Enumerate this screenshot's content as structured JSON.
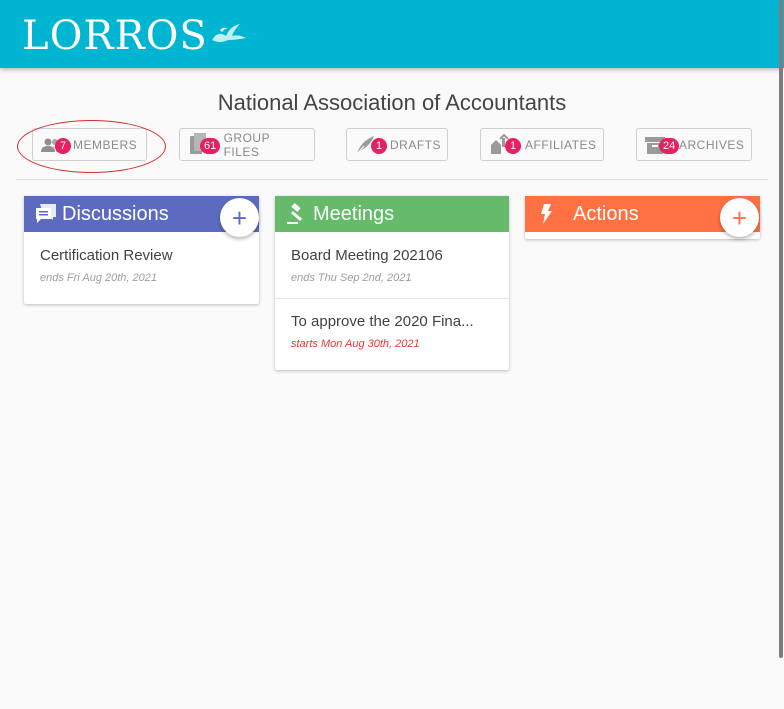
{
  "brand": {
    "logo_text": "LORROS",
    "bar_color": "#00b5d1"
  },
  "group_title": "National Association of Accountants",
  "tabs": [
    {
      "label": "MEMBERS",
      "count": "7",
      "icon": "people-icon"
    },
    {
      "label": "GROUP FILES",
      "count": "61",
      "icon": "files-icon"
    },
    {
      "label": "DRAFTS",
      "count": "1",
      "icon": "quill-icon"
    },
    {
      "label": "AFFILIATES",
      "count": "1",
      "icon": "affiliates-icon"
    },
    {
      "label": "ARCHIVES",
      "count": "24",
      "icon": "archive-icon"
    }
  ],
  "columns": {
    "discussions": {
      "title": "Discussions",
      "color": "#5c6bc0",
      "add_label": "+",
      "items": [
        {
          "title": "Certification Review",
          "subtitle": "ends Fri Aug 20th, 2021"
        }
      ]
    },
    "meetings": {
      "title": "Meetings",
      "color": "#66bb6a",
      "items": [
        {
          "title": "Board Meeting 202106",
          "subtitle": "ends Thu Sep 2nd, 2021"
        },
        {
          "title": "To approve the 2020 Fina...",
          "subtitle": "starts Mon Aug 30th, 2021"
        }
      ]
    },
    "actions": {
      "title": "Actions",
      "color": "#ff7043",
      "add_label": "+",
      "items": []
    }
  },
  "colors": {
    "badge": "#e91e63",
    "highlight": "#d32f2f",
    "overdue": "#e53935"
  }
}
